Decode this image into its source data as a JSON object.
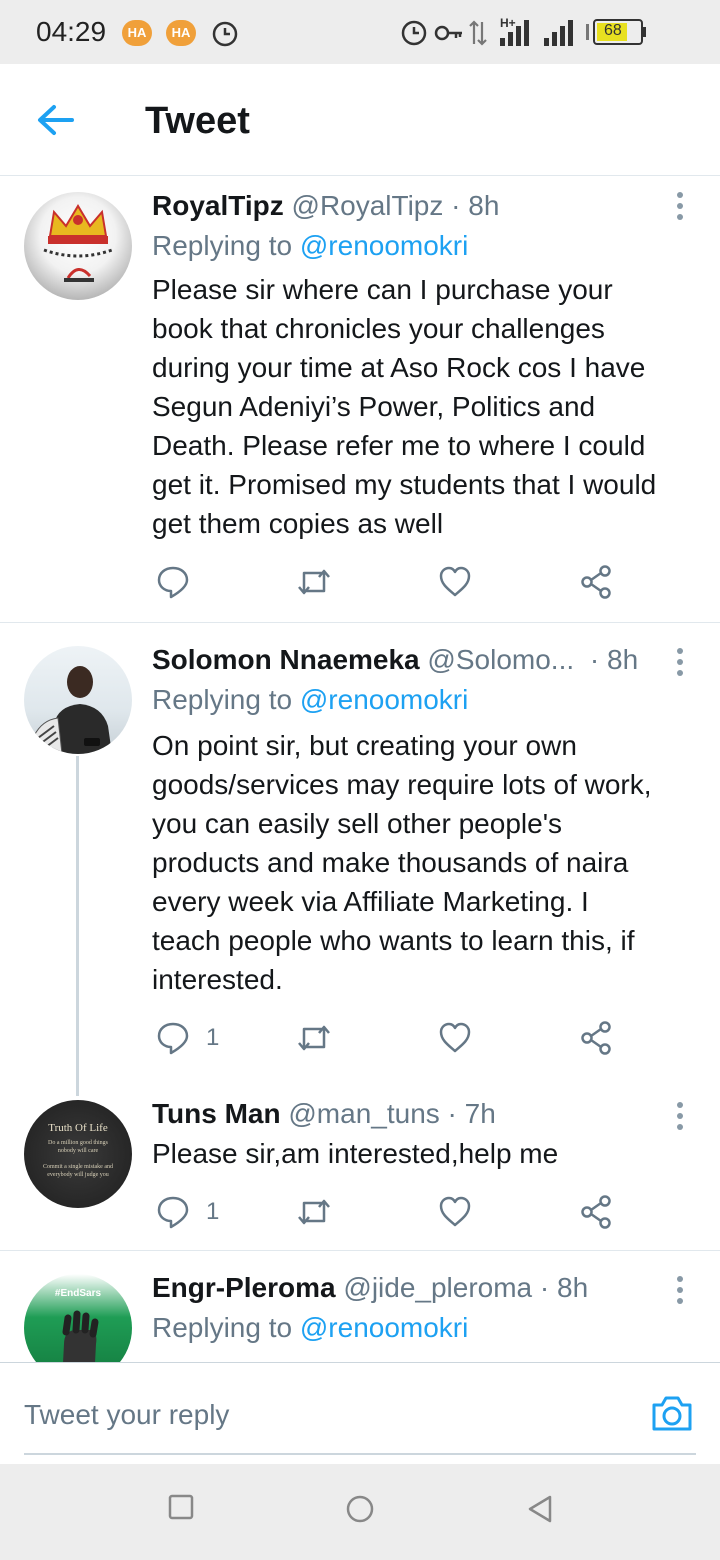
{
  "status_bar": {
    "time": "04:29",
    "badge1": "HA",
    "badge2": "HA",
    "network": "H+",
    "battery": "68"
  },
  "header": {
    "back_icon": "arrow-left-icon",
    "title": "Tweet"
  },
  "colors": {
    "accent": "#1da1f2",
    "secondary_text": "#657786",
    "primary_text": "#14171a",
    "divider": "#e1e8ed"
  },
  "tweets": [
    {
      "name": "RoyalTipz",
      "handle": "@RoyalTipz",
      "time": "· 8h",
      "replying_prefix": "Replying to",
      "replying_to": "@renoomokri",
      "text_lines": [
        "Please sir where can I purchase your",
        "book that chronicles your challenges",
        "during your time at Aso Rock cos I have",
        "Segun Adeniyi’s Power, Politics and",
        "Death. Please refer me to where I could",
        "get it. Promised my students that I would",
        "get them copies as well"
      ],
      "reply_count": ""
    },
    {
      "name": "Solomon Nnaemeka",
      "handle": "@Solomo...",
      "time": "· 8h",
      "replying_prefix": "Replying to",
      "replying_to": "@renoomokri",
      "text_lines": [
        "On point sir, but creating your own",
        "goods/services may require lots of work,",
        "you can easily sell other people's",
        "products and make thousands of naira",
        "every week via Affiliate Marketing. I",
        "teach people who wants to learn this, if",
        "interested."
      ],
      "reply_count": "1"
    },
    {
      "name": "Tuns Man",
      "handle": "@man_tuns",
      "time": "· 7h",
      "text_lines": [
        "Please sir,am interested,help me"
      ],
      "reply_count": "1",
      "avatar_title": "Truth Of Life",
      "avatar_line1": "Do a million good things",
      "avatar_line2": "nobody will care",
      "avatar_line3": "Commit a single mistake and",
      "avatar_line4": "everybody will judge you"
    },
    {
      "name": "Engr-Pleroma",
      "handle": "@jide_pleroma",
      "time": "· 8h",
      "replying_prefix": "Replying to",
      "replying_to": "@renoomokri",
      "avatar_tag": "#EndSars"
    }
  ],
  "reply_box": {
    "placeholder": "Tweet your reply",
    "camera_icon": "camera-icon"
  },
  "nav": {
    "recents_icon": "square-icon",
    "home_icon": "circle-icon",
    "back_icon": "triangle-back-icon"
  }
}
